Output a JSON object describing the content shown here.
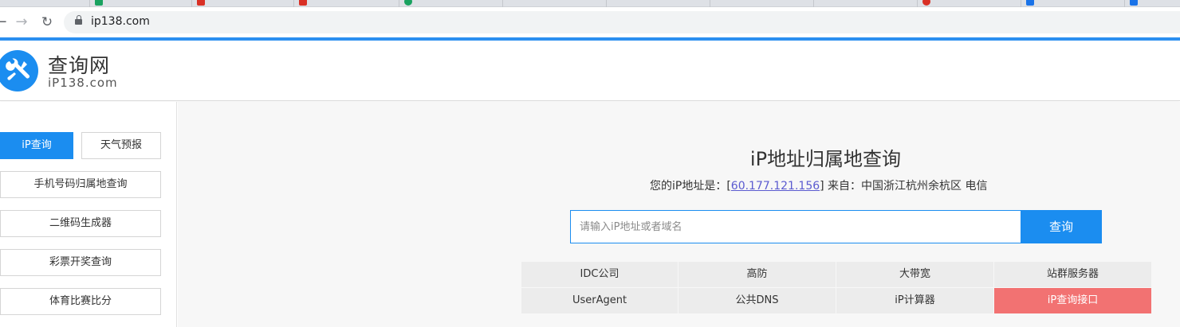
{
  "browser": {
    "url": "ip138.com",
    "tab_icon_colors": [
      "#1aa260",
      "#d93025",
      "#d93025",
      "#1aa260",
      "#9aa0a6",
      "#9aa0a6",
      "#9aa0a6",
      "#9aa0a6",
      "#d93025",
      "#1a73e8",
      "#1a73e8"
    ]
  },
  "header": {
    "logo_title": "查询网",
    "logo_domain": "iP138.com",
    "brand_color": "#1b8df0"
  },
  "sidebar": {
    "tabs": [
      {
        "label": "iP查询",
        "active": true
      },
      {
        "label": "天气预报",
        "active": false
      }
    ],
    "items": [
      {
        "label": "手机号码归属地查询"
      },
      {
        "label": "二维码生成器"
      },
      {
        "label": "彩票开奖查询"
      },
      {
        "label": "体育比赛比分"
      }
    ]
  },
  "main": {
    "title": "iP地址归属地查询",
    "ip_prefix": "您的iP地址是：[",
    "ip_address": "60.177.121.156",
    "ip_suffix": "] 来自：中国浙江杭州余杭区 电信",
    "search_placeholder": "请输入iP地址或者域名",
    "search_button": "查询",
    "links": [
      {
        "label": "IDC公司",
        "highlight": false
      },
      {
        "label": "高防",
        "highlight": false
      },
      {
        "label": "大带宽",
        "highlight": false
      },
      {
        "label": "站群服务器",
        "highlight": false
      },
      {
        "label": "UserAgent",
        "highlight": false
      },
      {
        "label": "公共DNS",
        "highlight": false
      },
      {
        "label": "iP计算器",
        "highlight": false
      },
      {
        "label": "iP查询接口",
        "highlight": true
      }
    ],
    "highlight_color": "#f27272"
  }
}
